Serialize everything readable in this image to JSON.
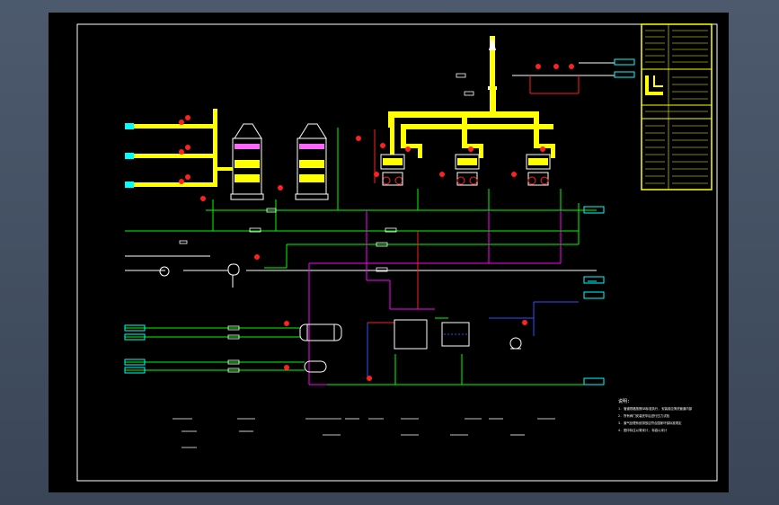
{
  "notes": {
    "title": "说明:",
    "lines": [
      "1. 管道规格按照GB标准执行, 安装前应清洗管道内部",
      "2. 所有阀门安装完毕后进行压力试验",
      "3. 废气处理系统排放应符合国家环保标准规定",
      "4. 图中标注以毫米计, 标高以米计"
    ]
  },
  "colors": {
    "duct": "#ffff00",
    "pipe_green": "#00ff00",
    "pipe_magenta": "#ff00ff",
    "pipe_red": "#ff2020",
    "pipe_blue": "#3050ff",
    "pipe_cyan": "#00ffff",
    "outline": "#ffffff"
  },
  "icons": [
    "stack-icon",
    "scrubber-tower-icon",
    "fan-icon",
    "pump-icon",
    "heat-exchanger-icon",
    "tank-icon",
    "valve-icon",
    "instrument-bubble-icon"
  ]
}
